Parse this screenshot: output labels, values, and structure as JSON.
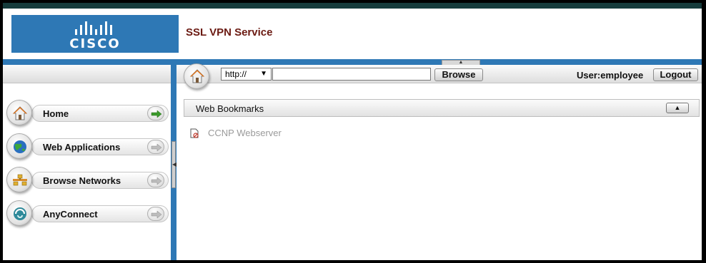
{
  "brand": {
    "logo_text": "CISCO",
    "title": "SSL VPN Service",
    "accent": "#2e78b5",
    "title_color": "#6b1a12"
  },
  "sidebar": {
    "items": [
      {
        "label": "Home",
        "icon": "home-icon",
        "arrow_color": "#3a9a2a"
      },
      {
        "label": "Web Applications",
        "icon": "globe-icon",
        "arrow_color": "#9a9a9a"
      },
      {
        "label": "Browse Networks",
        "icon": "network-icon",
        "arrow_color": "#9a9a9a"
      },
      {
        "label": "AnyConnect",
        "icon": "anyconnect-icon",
        "arrow_color": "#9a9a9a"
      }
    ]
  },
  "toolbar": {
    "protocol": "http://",
    "url_value": "",
    "browse_label": "Browse",
    "user_label": "User:employee",
    "logout_label": "Logout"
  },
  "bookmarks": {
    "title": "Web Bookmarks",
    "items": [
      {
        "label": "CCNP Webserver"
      }
    ]
  }
}
